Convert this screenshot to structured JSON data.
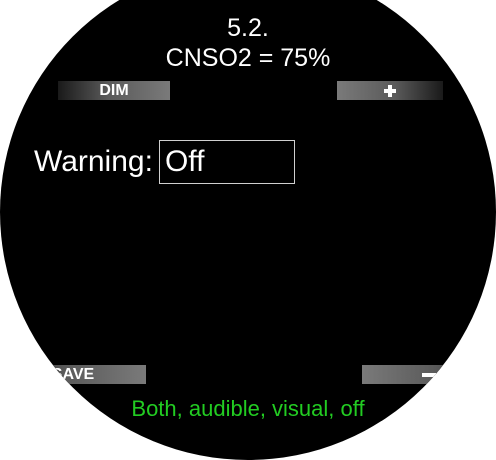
{
  "header": {
    "section_number": "5.2.",
    "title": "CNSO2 = 75%"
  },
  "softkeys": {
    "top_left_label": "DIM",
    "top_right_icon": "plus-icon",
    "bottom_left_label": "SAVE",
    "bottom_right_icon": "minus-icon"
  },
  "setting": {
    "label": "Warning:",
    "value": "Off"
  },
  "hint": "Both, audible, visual, off",
  "colors": {
    "background": "#000000",
    "text": "#ffffff",
    "hint": "#22cc22"
  }
}
